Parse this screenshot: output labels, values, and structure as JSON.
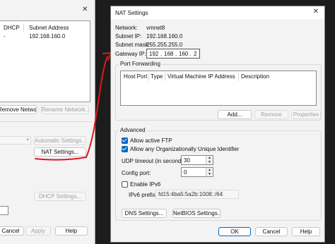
{
  "back_dialog": {
    "close_glyph": "✕",
    "table_headers": [
      "DHCP",
      "Subnet Address"
    ],
    "row": {
      "dhcp": "-",
      "subnet": "192.168.160.0"
    },
    "remove_network_label": "Remove Network",
    "rename_network_label": "Rename Network...",
    "automatic_settings_label": "Automatic Settings...",
    "nat_settings_label": "NAT Settings...",
    "dhcp_settings_label": "DHCP Settings...",
    "cancel_label": "Cancel",
    "apply_label": "Apply",
    "help_label": "Help"
  },
  "nat_dialog": {
    "title": "NAT Settings",
    "close_glyph": "✕",
    "network_label": "Network:",
    "network_value": "vmnet8",
    "subnet_ip_label": "Subnet IP:",
    "subnet_ip_value": "192.168.160.0",
    "subnet_mask_label": "Subnet mask:",
    "subnet_mask_value": "255.255.255.0",
    "gateway_label": "Gateway IP:",
    "gateway_octets": [
      "192",
      "168",
      "160",
      "2"
    ],
    "port_forwarding": {
      "title": "Port Forwarding",
      "columns": [
        "Host Port",
        "Type",
        "Virtual Machine IP Address",
        "Description"
      ],
      "add_label": "Add...",
      "remove_label": "Remove",
      "properties_label": "Properties"
    },
    "advanced": {
      "title": "Advanced",
      "allow_ftp_label": "Allow active FTP",
      "allow_ftp_checked": true,
      "allow_oui_label": "Allow any Organizationally Unique Identifier",
      "allow_oui_checked": true,
      "udp_timeout_label": "UDP timeout (in seconds):",
      "udp_timeout_value": "30",
      "config_port_label": "Config port:",
      "config_port_value": "0",
      "enable_ipv6_label": "Enable IPv6",
      "enable_ipv6_checked": false,
      "ipv6_prefix_label": "IPv6 prefix:",
      "ipv6_prefix_value": "fd15:4ba5:5a2b:1008::/64",
      "dns_settings_label": "DNS Settings...",
      "netbios_settings_label": "NetBIOS Settings..."
    },
    "ok_label": "OK",
    "cancel_label": "Cancel",
    "help_label": "Help"
  },
  "annotation_color": "#e0161e"
}
